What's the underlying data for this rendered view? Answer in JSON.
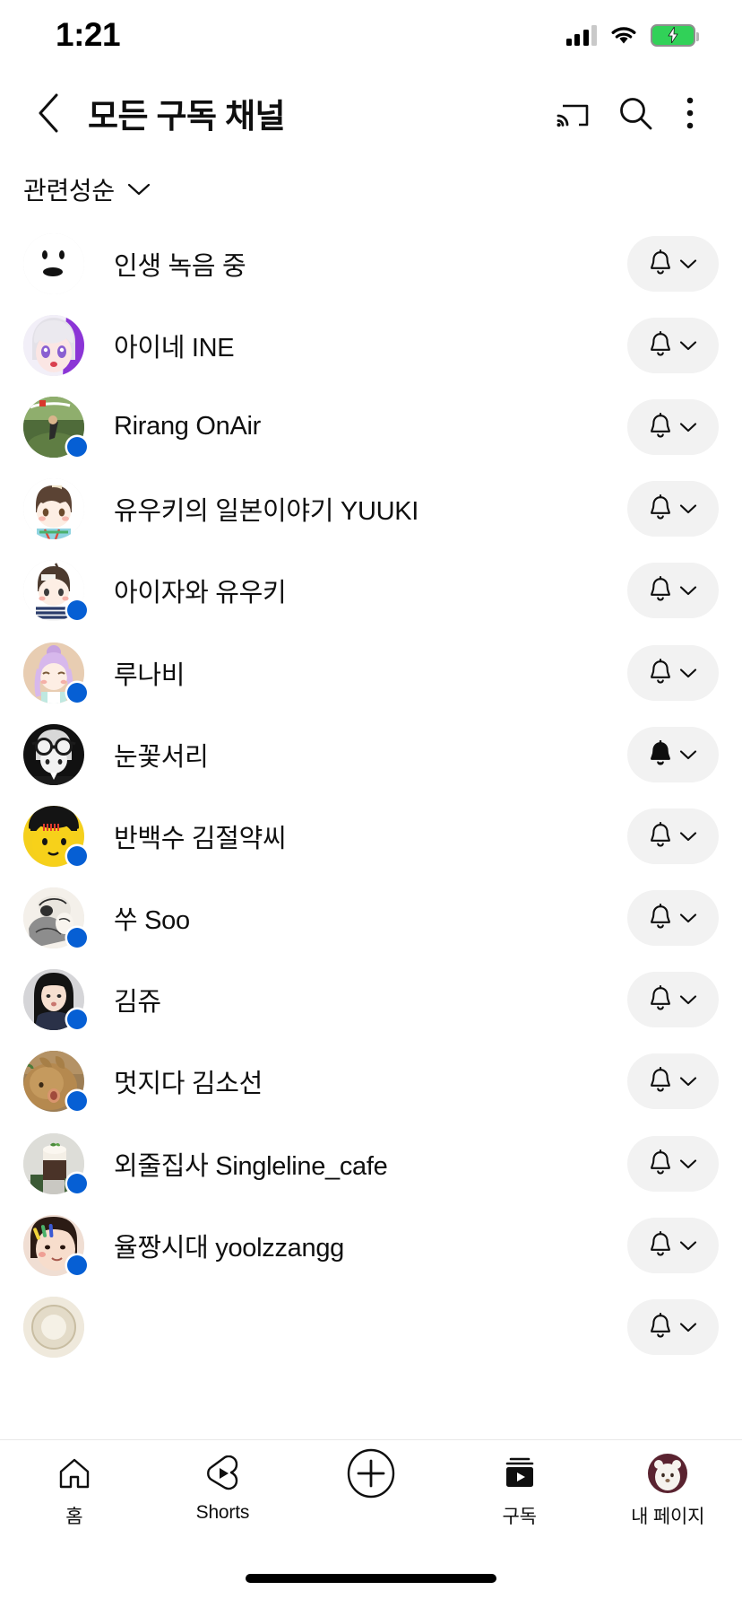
{
  "status_bar": {
    "time": "1:21",
    "signal_icon": "cellular-signal-icon",
    "signal_bars_filled": 3,
    "signal_bars_total": 4,
    "wifi_icon": "wifi-icon",
    "battery_icon": "battery-charging-icon",
    "battery_color": "#31d158",
    "battery_charging": true
  },
  "header": {
    "back_icon": "chevron-left-icon",
    "title": "모든 구독 채널",
    "cast_icon": "cast-icon",
    "search_icon": "search-icon",
    "more_icon": "more-vertical-icon"
  },
  "filter": {
    "label": "관련성순",
    "chevron_icon": "chevron-down-icon"
  },
  "list": {
    "bell_icon": "bell-icon",
    "bell_filled_icon": "bell-filled-icon",
    "chevron_icon": "chevron-down-icon",
    "new_badge_color": "#065fd4",
    "chip_color": "#f2f2f2",
    "channels": [
      {
        "name": "인생 녹음 중",
        "avatar": "white-face-dots-avatar",
        "new_content": false,
        "bell_state": "default"
      },
      {
        "name": "아이네 INE",
        "avatar": "anime-white-hair-purple-avatar",
        "new_content": false,
        "bell_state": "default"
      },
      {
        "name": "Rirang OnAir",
        "avatar": "outdoor-photo-logo-avatar",
        "new_content": true,
        "bell_state": "default"
      },
      {
        "name": "유우키의 일본이야기 YUUKI",
        "avatar": "chibi-brown-hair-avatar",
        "new_content": false,
        "bell_state": "default"
      },
      {
        "name": "아이자와 유우키",
        "avatar": "chibi-striped-shirt-avatar",
        "new_content": true,
        "bell_state": "default"
      },
      {
        "name": "루나비",
        "avatar": "chibi-purple-bun-avatar",
        "new_content": true,
        "bell_state": "default"
      },
      {
        "name": "눈꽃서리",
        "avatar": "monochrome-goggles-avatar",
        "new_content": false,
        "bell_state": "all"
      },
      {
        "name": "반백수 김절약씨",
        "avatar": "yellow-face-black-hair-avatar",
        "new_content": true,
        "bell_state": "default"
      },
      {
        "name": "쑤 Soo",
        "avatar": "grayscale-illustration-avatar",
        "new_content": true,
        "bell_state": "default"
      },
      {
        "name": "김쥬",
        "avatar": "woman-long-black-hair-photo-avatar",
        "new_content": true,
        "bell_state": "default"
      },
      {
        "name": "멋지다 김소선",
        "avatar": "rabbit-photo-avatar",
        "new_content": true,
        "bell_state": "default"
      },
      {
        "name": "외줄집사 Singleline_cafe",
        "avatar": "latte-drink-photo-avatar",
        "new_content": true,
        "bell_state": "default"
      },
      {
        "name": "율짱시대 yoolzzangg",
        "avatar": "selfie-hairpins-photo-avatar",
        "new_content": true,
        "bell_state": "default"
      },
      {
        "name": "",
        "avatar": "cream-circle-avatar",
        "new_content": false,
        "bell_state": "default"
      }
    ]
  },
  "bottom_nav": {
    "items": [
      {
        "label": "홈",
        "icon": "home-icon",
        "active": false
      },
      {
        "label": "Shorts",
        "icon": "shorts-icon",
        "active": false
      },
      {
        "label": "",
        "icon": "create-plus-icon",
        "active": false
      },
      {
        "label": "구독",
        "icon": "subscriptions-icon",
        "active": true
      },
      {
        "label": "내 페이지",
        "icon": "account-avatar-icon",
        "active": false
      }
    ]
  }
}
